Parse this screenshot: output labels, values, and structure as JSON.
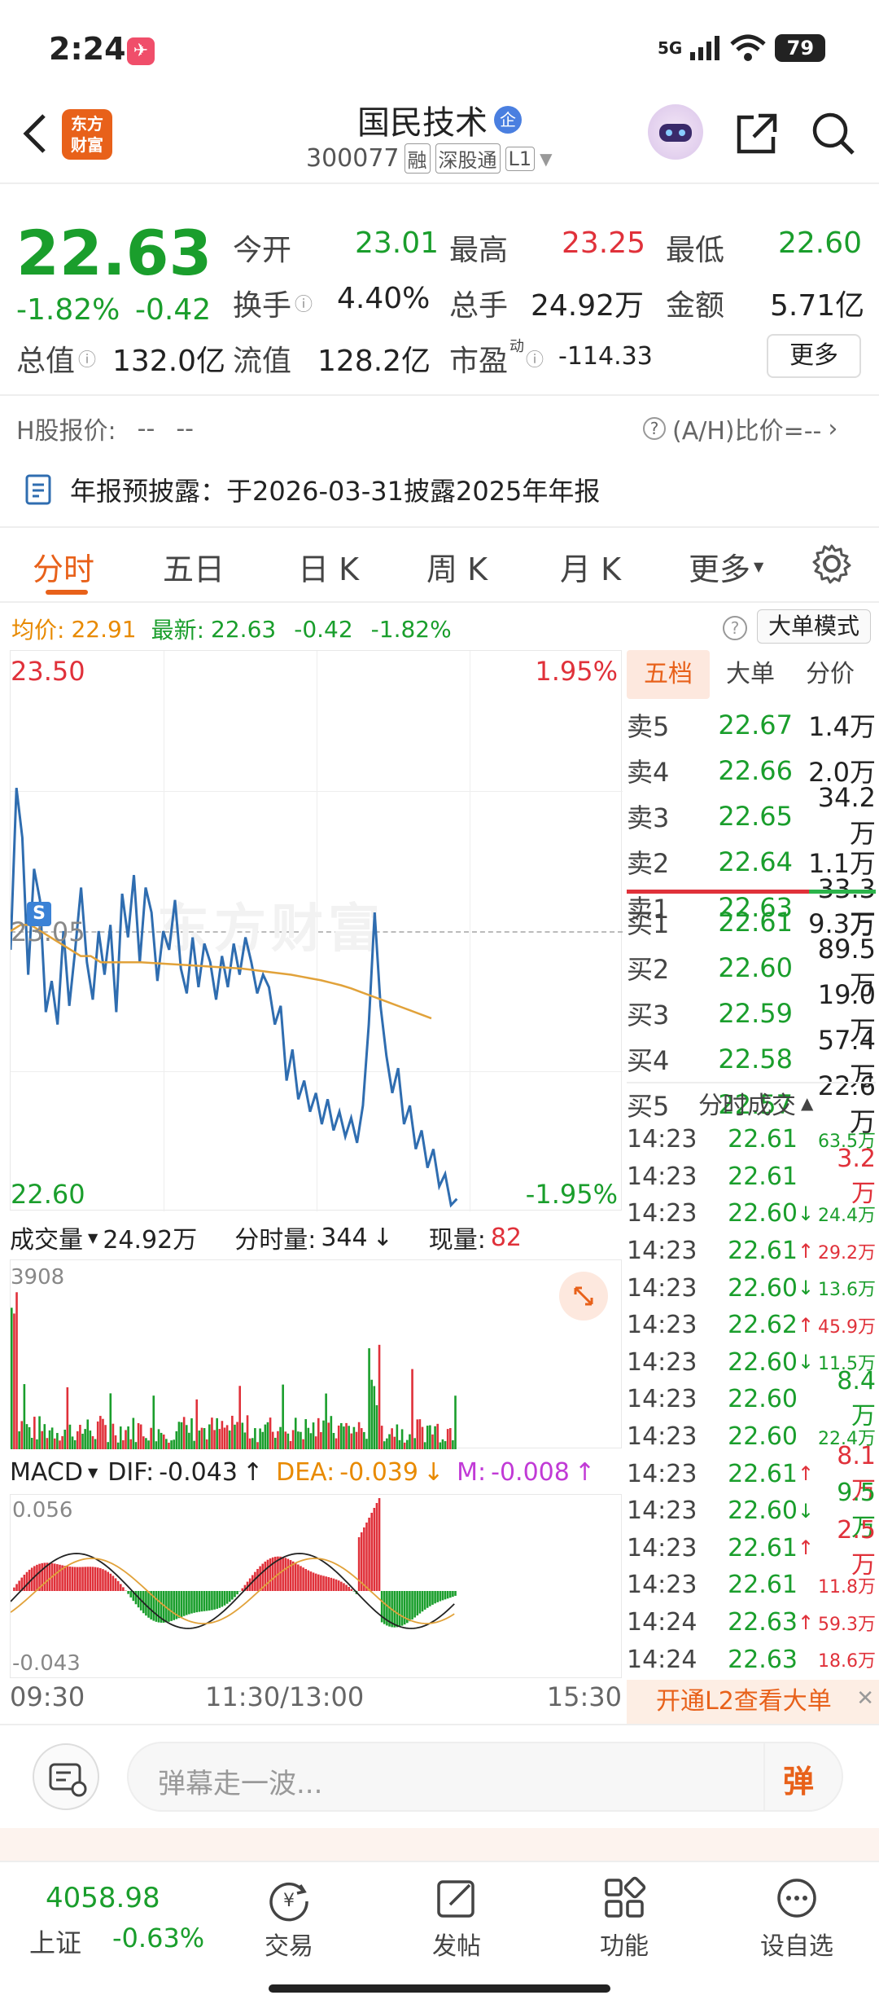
{
  "status_bar": {
    "time": "2:24",
    "network": "5G",
    "battery": "79"
  },
  "header": {
    "logo_line1": "东方",
    "logo_line2": "财富",
    "stock_name": "国民技术",
    "enterprise_badge": "企",
    "stock_code": "300077",
    "tag_margin": "融",
    "tag_connect": "深股通",
    "tag_level": "L1"
  },
  "quote": {
    "price": "22.63",
    "change_pct": "-1.82%",
    "change": "-0.42",
    "open_label": "今开",
    "open": "23.01",
    "high_label": "最高",
    "high": "23.25",
    "low_label": "最低",
    "low": "22.60",
    "turnover_label": "换手",
    "turnover": "4.40%",
    "volume_label": "总手",
    "volume": "24.92万",
    "amount_label": "金额",
    "amount": "5.71亿",
    "mcap_label": "总值",
    "mcap": "132.0亿",
    "float_label": "流值",
    "float": "128.2亿",
    "pe_label": "市盈",
    "pe_sup": "动",
    "pe": "-114.33",
    "more_button": "更多"
  },
  "hshare": {
    "label": "H股报价:",
    "value1": "--",
    "value2": "--",
    "ah_label": "(A/H)比价=--"
  },
  "notice": {
    "text": "年报预披露：于2026-03-31披露2025年年报"
  },
  "tabs": [
    {
      "label": "分时",
      "active": true
    },
    {
      "label": "五日"
    },
    {
      "label": "日 K"
    },
    {
      "label": "周 K"
    },
    {
      "label": "月 K"
    },
    {
      "label": "更多"
    }
  ],
  "chart_info": {
    "avg_label": "均价:",
    "avg": "22.91",
    "latest_label": "最新:",
    "latest": "22.63",
    "change": "-0.42",
    "pct": "-1.82%",
    "big_order_mode": "大单模式"
  },
  "chart_labels": {
    "y_top": "23.50",
    "y_top_pct": "1.95%",
    "y_bottom": "22.60",
    "y_bottom_pct": "-1.95%",
    "y_mid": "23.05",
    "marker": "S",
    "watermark": "东方财富",
    "x_start": "09:30",
    "x_mid": "11:30/13:00",
    "x_end": "15:30"
  },
  "chart_data": {
    "type": "line",
    "title": "",
    "xlabel": "",
    "ylabel": "",
    "ylim": [
      22.6,
      23.5
    ],
    "x": [
      "09:30",
      "11:30/13:00",
      "15:30"
    ],
    "series": [
      {
        "name": "最新",
        "color": "#2f6db0",
        "values": [
          23.02,
          23.28,
          23.2,
          22.98,
          23.15,
          23.1,
          22.92,
          22.97,
          22.9,
          23.05,
          22.93,
          23.02,
          23.12,
          23.0,
          22.94,
          23.05,
          22.98,
          23.06,
          22.92,
          23.11,
          23.04,
          23.14,
          23.0,
          23.12,
          23.08,
          22.97,
          23.05,
          23.02,
          23.1,
          22.99,
          22.95,
          23.04,
          22.96,
          23.03,
          23.0,
          22.94,
          23.01,
          22.96,
          23.03,
          22.98,
          23.04,
          23.0,
          22.95,
          22.98,
          22.96,
          22.9,
          22.93,
          22.81,
          22.86,
          22.78,
          22.81,
          22.76,
          22.79,
          22.74,
          22.78,
          22.73,
          22.76,
          22.72,
          22.75,
          22.71,
          22.77,
          22.9,
          23.08,
          22.93,
          22.85,
          22.79,
          22.83,
          22.74,
          22.77,
          22.7,
          22.73,
          22.67,
          22.7,
          22.64,
          22.66,
          22.61,
          22.62
        ]
      },
      {
        "name": "均价",
        "color": "#e1a23a",
        "values": [
          23.05,
          23.06,
          23.06,
          23.05,
          23.04,
          23.03,
          23.02,
          23.01,
          23.01,
          23.0,
          23.0,
          23.0,
          23.0,
          23.0,
          22.999,
          22.998,
          22.997,
          22.996,
          22.995,
          22.994,
          22.993,
          22.992,
          22.991,
          22.99,
          22.988,
          22.986,
          22.984,
          22.982,
          22.98,
          22.977,
          22.974,
          22.971,
          22.967,
          22.963,
          22.958,
          22.952,
          22.946,
          22.94,
          22.934,
          22.928,
          22.922,
          22.916,
          22.91
        ]
      }
    ],
    "volume_max": "3908",
    "macd": {
      "dif": "-0.043",
      "dea": "-0.039",
      "m": "-0.008",
      "ymax": "0.056",
      "ymin": "-0.043"
    }
  },
  "volume_bar": {
    "label": "成交量",
    "value": "24.92万",
    "period_label": "分时量:",
    "period": "344",
    "now_label": "现量:",
    "now": "82"
  },
  "macd_bar": {
    "label": "MACD",
    "dif_label": "DIF:",
    "dif": "-0.043",
    "dea_label": "DEA:",
    "dea": "-0.039",
    "m_label": "M:",
    "m": "-0.008"
  },
  "orderbook": {
    "tabs": [
      "五档",
      "大单",
      "分价"
    ],
    "sells": [
      {
        "label": "卖5",
        "price": "22.67",
        "vol": "1.4万"
      },
      {
        "label": "卖4",
        "price": "22.66",
        "vol": "2.0万"
      },
      {
        "label": "卖3",
        "price": "22.65",
        "vol": "34.2万"
      },
      {
        "label": "卖2",
        "price": "22.64",
        "vol": "1.1万"
      },
      {
        "label": "卖1",
        "price": "22.63",
        "vol": "33.3万"
      }
    ],
    "buys": [
      {
        "label": "买1",
        "price": "22.61",
        "vol": "9.3万"
      },
      {
        "label": "买2",
        "price": "22.60",
        "vol": "89.5万"
      },
      {
        "label": "买3",
        "price": "22.59",
        "vol": "19.0万"
      },
      {
        "label": "买4",
        "price": "22.58",
        "vol": "57.4万"
      },
      {
        "label": "买5",
        "price": "22.57",
        "vol": "22.6万"
      }
    ],
    "ticks_title": "分时成交",
    "ticks": [
      {
        "t": "14:23",
        "p": "22.61",
        "arrow": "",
        "v": "63.5万",
        "c": "green",
        "small": true
      },
      {
        "t": "14:23",
        "p": "22.61",
        "arrow": "",
        "v": "3.2万",
        "c": "red",
        "small": false
      },
      {
        "t": "14:23",
        "p": "22.60",
        "arrow": "↓",
        "v": "24.4万",
        "c": "green",
        "small": true
      },
      {
        "t": "14:23",
        "p": "22.61",
        "arrow": "↑",
        "v": "29.2万",
        "c": "red",
        "small": true
      },
      {
        "t": "14:23",
        "p": "22.60",
        "arrow": "↓",
        "v": "13.6万",
        "c": "green",
        "small": true
      },
      {
        "t": "14:23",
        "p": "22.62",
        "arrow": "↑",
        "v": "45.9万",
        "c": "red",
        "small": true
      },
      {
        "t": "14:23",
        "p": "22.60",
        "arrow": "↓",
        "v": "11.5万",
        "c": "green",
        "small": true
      },
      {
        "t": "14:23",
        "p": "22.60",
        "arrow": "",
        "v": "8.4万",
        "c": "green",
        "small": false
      },
      {
        "t": "14:23",
        "p": "22.60",
        "arrow": "",
        "v": "22.4万",
        "c": "green",
        "small": true
      },
      {
        "t": "14:23",
        "p": "22.61",
        "arrow": "↑",
        "v": "8.1万",
        "c": "red",
        "small": false
      },
      {
        "t": "14:23",
        "p": "22.60",
        "arrow": "↓",
        "v": "9.5万",
        "c": "green",
        "small": false
      },
      {
        "t": "14:23",
        "p": "22.61",
        "arrow": "↑",
        "v": "2.5万",
        "c": "red",
        "small": false
      },
      {
        "t": "14:23",
        "p": "22.61",
        "arrow": "",
        "v": "11.8万",
        "c": "red",
        "small": true
      },
      {
        "t": "14:24",
        "p": "22.63",
        "arrow": "↑",
        "v": "59.3万",
        "c": "red",
        "small": true
      },
      {
        "t": "14:24",
        "p": "22.63",
        "arrow": "",
        "v": "18.6万",
        "c": "red",
        "small": true
      }
    ],
    "l2_banner": "开通L2查看大单"
  },
  "comment": {
    "placeholder": "弹幕走一波...",
    "danmu": "弹"
  },
  "bottom_nav": {
    "index_value": "4058.98",
    "index_name": "上证",
    "index_pct": "-0.63%",
    "items": [
      {
        "label": "交易",
        "icon": "trade-icon"
      },
      {
        "label": "发帖",
        "icon": "post-icon"
      },
      {
        "label": "功能",
        "icon": "apps-icon"
      },
      {
        "label": "设自选",
        "icon": "watchlist-icon"
      }
    ]
  },
  "colors": {
    "up": "#e0313a",
    "down": "#1a9e2c",
    "accent": "#e8611a",
    "line": "#2f6db0",
    "avg": "#e1a23a"
  }
}
